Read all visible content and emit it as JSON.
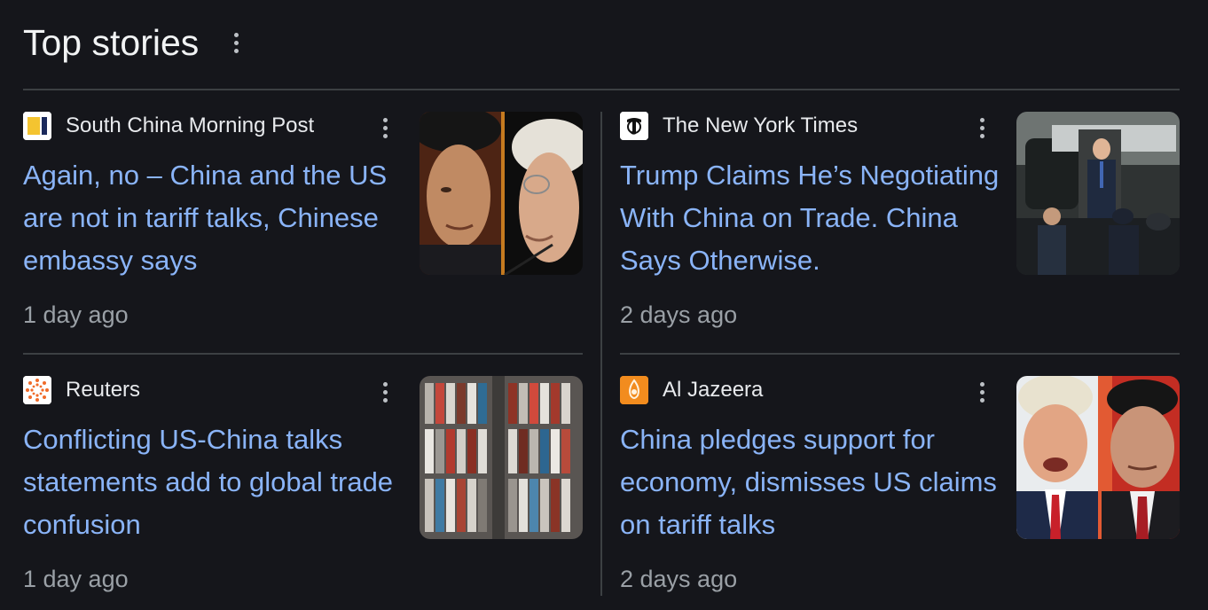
{
  "section": {
    "title": "Top stories",
    "menu_icon": "more-vert-icon"
  },
  "stories": [
    {
      "source": "South China Morning Post",
      "favicon": "scmp-logo-icon",
      "headline": "Again, no – China and the US are not in tariff talks, Chinese embassy says",
      "time": "1 day ago",
      "thumbnail": "split-portrait-photo"
    },
    {
      "source": "The New York Times",
      "favicon": "nyt-logo-icon",
      "headline": "Trump Claims He’s Negotiating With China on Trade. China Says Otherwise.",
      "time": "2 days ago",
      "thumbnail": "helicopter-stairs-photo"
    },
    {
      "source": "Reuters",
      "favicon": "reuters-logo-icon",
      "headline": "Conflicting US-China talks statements add to global trade confusion",
      "time": "1 day ago",
      "thumbnail": "shipping-containers-photo"
    },
    {
      "source": "Al Jazeera",
      "favicon": "aljazeera-logo-icon",
      "headline": "China pledges support for economy, dismisses US claims on tariff talks",
      "time": "2 days ago",
      "thumbnail": "split-portrait-photo"
    }
  ],
  "colors": {
    "background": "#15161b",
    "headline": "#8ab4f8",
    "meta": "#9aa0a6",
    "divider": "#3c4043"
  }
}
